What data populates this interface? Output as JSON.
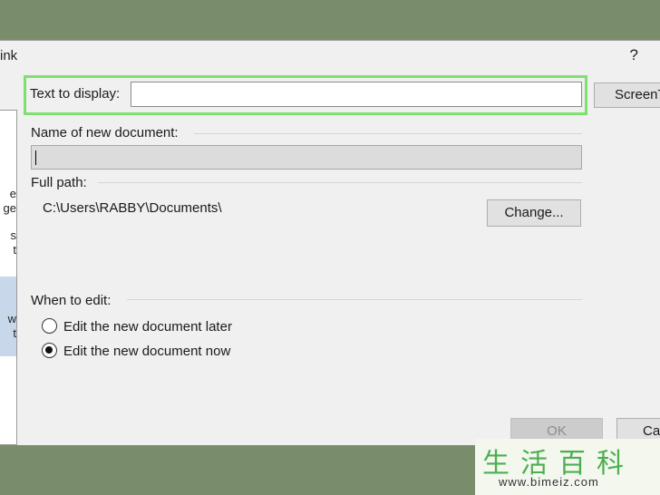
{
  "window": {
    "title": "ink",
    "help": "?"
  },
  "sidebar": {
    "items": [
      {
        "label": "e\nge"
      },
      {
        "label": "s\nt"
      },
      {
        "label": "w\nt"
      }
    ]
  },
  "text_to_display": {
    "label": "Text to display:",
    "value": ""
  },
  "screentip_button": "ScreenTip...",
  "new_document": {
    "name_label": "Name of new document:",
    "name_value": "",
    "full_path_label": "Full path:",
    "full_path_value": "C:\\Users\\RABBY\\Documents\\",
    "change_button": "Change..."
  },
  "when_to_edit": {
    "label": "When to edit:",
    "options": [
      {
        "label": "Edit the new document later",
        "selected": false
      },
      {
        "label": "Edit the new document now",
        "selected": true
      }
    ]
  },
  "footer": {
    "ok_button": "OK",
    "cancel_button": "Cancel"
  },
  "watermark": {
    "chars": "生活百科",
    "url": "www.bimeiz.com"
  },
  "colors": {
    "background": "#7a8d6b",
    "dialog": "#f0f0f0",
    "highlight": "#7ee06e"
  }
}
